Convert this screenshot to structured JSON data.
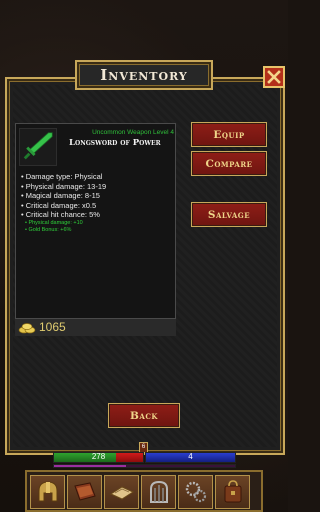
{
  "window": {
    "title": "Inventory"
  },
  "item": {
    "tier": "Uncommon Weapon Level 4",
    "name": "Longsword of Power",
    "stats": [
      "• Damage type: Physical",
      "• Physical damage: 13-19",
      "• Magical damage: 8-15",
      "• Critical damage: x0.5",
      "• Critical hit chance: 5%"
    ],
    "bonuses": [
      "• Physical damage: +10",
      "• Gold Bonus: +6%"
    ]
  },
  "gold": {
    "amount": "1065"
  },
  "actions": {
    "equip": "Equip",
    "compare": "Compare",
    "salvage": "Salvage",
    "back": "Back"
  },
  "hud": {
    "hp": "278",
    "hp_fill_percent": 70,
    "mp": "4",
    "xp_fill_percent": 40,
    "level_marker": "6"
  },
  "toolbar": {
    "icons": [
      "helmet-icon",
      "spellbook-icon",
      "map-icon",
      "gate-icon",
      "gears-icon",
      "bag-icon"
    ]
  },
  "colors": {
    "frame_gold": "#c8a85a",
    "button_red": "#8f1e17",
    "tier_green": "#2fbf3a",
    "gold_text": "#e0cc70"
  }
}
